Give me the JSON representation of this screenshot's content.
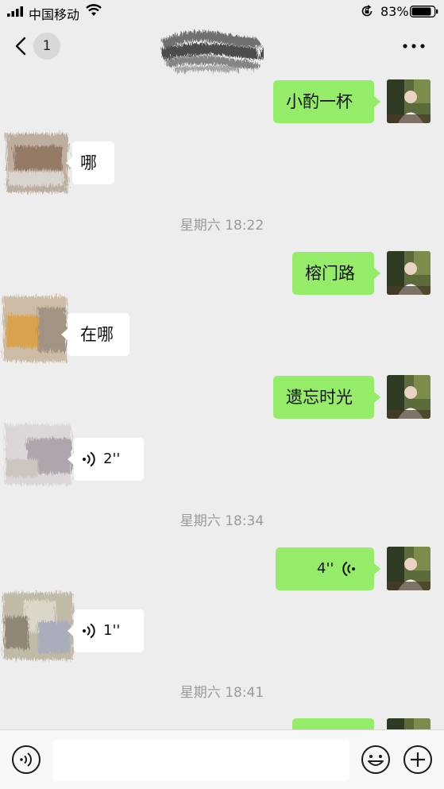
{
  "status_bar": {
    "carrier": "中国移动",
    "battery_percent": "83%"
  },
  "nav": {
    "unread_count": "1"
  },
  "chat": {
    "messages": [
      {
        "sender": "me",
        "type": "text",
        "text": "小酌一杯"
      },
      {
        "sender": "other",
        "type": "text",
        "text": "哪"
      },
      {
        "type": "timestamp",
        "text": "星期六 18:22"
      },
      {
        "sender": "me",
        "type": "text",
        "text": "榕门路"
      },
      {
        "sender": "other",
        "type": "text",
        "text": "在哪"
      },
      {
        "sender": "me",
        "type": "text",
        "text": "遗忘时光"
      },
      {
        "sender": "other",
        "type": "voice",
        "duration": "2''"
      },
      {
        "type": "timestamp",
        "text": "星期六 18:34"
      },
      {
        "sender": "me",
        "type": "voice",
        "duration": "4''"
      },
      {
        "sender": "other",
        "type": "voice",
        "duration": "1''"
      },
      {
        "type": "timestamp",
        "text": "星期六 18:41"
      },
      {
        "sender": "me",
        "type": "text",
        "text": ""
      }
    ]
  },
  "input_bar": {
    "text_value": ""
  },
  "colors": {
    "background": "#ededed",
    "my_bubble": "#95ec69",
    "other_bubble": "#ffffff",
    "timestamp": "#9a9a9a"
  },
  "icons": [
    "signal-icon",
    "wifi-icon",
    "rotation-lock-icon",
    "battery-icon",
    "back-chevron-icon",
    "more-icon",
    "voice-wave-icon",
    "voice-input-icon",
    "emoji-icon",
    "plus-icon"
  ]
}
